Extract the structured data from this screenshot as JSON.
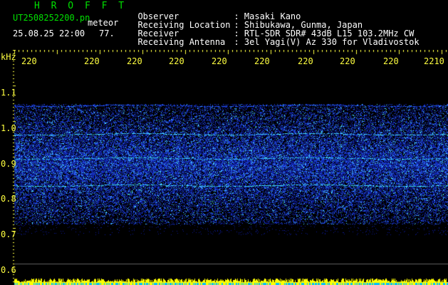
{
  "header": {
    "station_title": "H R O F F T",
    "filename": "UT2508252200.pn",
    "mode": "meteor",
    "datetime": "25.08.25 22:00",
    "count": "77."
  },
  "info": [
    {
      "label": "Observer",
      "value": ": Masaki Kano"
    },
    {
      "label": "Receiving Location",
      "value": ": Shibukawa, Gunma, Japan"
    },
    {
      "label": "Receiver",
      "value": ": RTL-SDR SDR# 43dB L15 103.2MHz CW"
    },
    {
      "label": "Receiving Antenna",
      "value": ": 3el Yagi(V) Az 330 for Vladivostok"
    }
  ],
  "axes": {
    "y_unit": "kHz",
    "y_ticks": [
      "1.1",
      "1.0",
      "0.9",
      "0.8",
      "0.7",
      "0.6"
    ],
    "x_ticks": [
      "220",
      "220",
      "220",
      "220",
      "220",
      "220",
      "220",
      "220",
      "220",
      "2210"
    ]
  },
  "colors": {
    "background": "#000000",
    "title": "#00e000",
    "text": "#ffffff",
    "axis": "#ffff40",
    "signal_low": "#1010a0",
    "signal_high": "#40e0ff",
    "level_bar": "#ffff00"
  }
}
